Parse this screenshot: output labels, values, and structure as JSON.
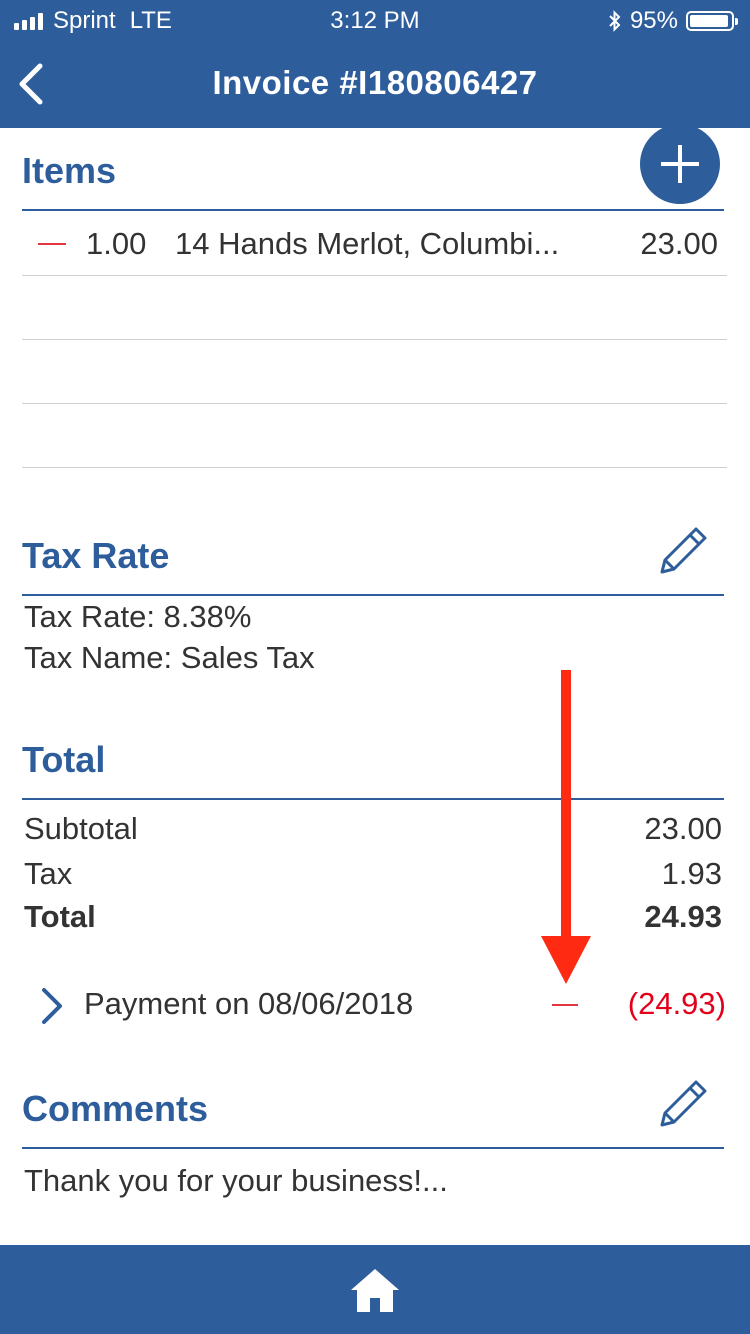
{
  "status": {
    "carrier": "Sprint",
    "network": "LTE",
    "time": "3:12 PM",
    "battery": "95%",
    "battery_level": 0.95
  },
  "nav": {
    "title": "Invoice #I180806427",
    "back_icon": "chevron-left-icon"
  },
  "items": {
    "heading": "Items",
    "add_icon": "plus-circle-icon",
    "rows": [
      {
        "qty": "1.00",
        "description": "14 Hands Merlot, Columbi...",
        "amount": "23.00"
      }
    ]
  },
  "tax": {
    "heading": "Tax Rate",
    "rate_line": "Tax Rate: 8.38%",
    "name_line": "Tax Name: Sales Tax",
    "edit_icon": "pencil-icon"
  },
  "total": {
    "heading": "Total",
    "subtotal_label": "Subtotal",
    "subtotal_value": "23.00",
    "tax_label": "Tax",
    "tax_value": "1.93",
    "total_label": "Total",
    "total_value": "24.93"
  },
  "payment": {
    "label": "Payment on 08/06/2018",
    "amount": "(24.93)",
    "amount_color": "#e3001b"
  },
  "comments": {
    "heading": "Comments",
    "text": "Thank you for your business!...",
    "edit_icon": "pencil-icon"
  },
  "annotation": {
    "arrow_color": "#ff2a12"
  },
  "colors": {
    "brand": "#2e5d9c",
    "delete": "#e3383f"
  },
  "bottom": {
    "home_icon": "home-icon"
  }
}
